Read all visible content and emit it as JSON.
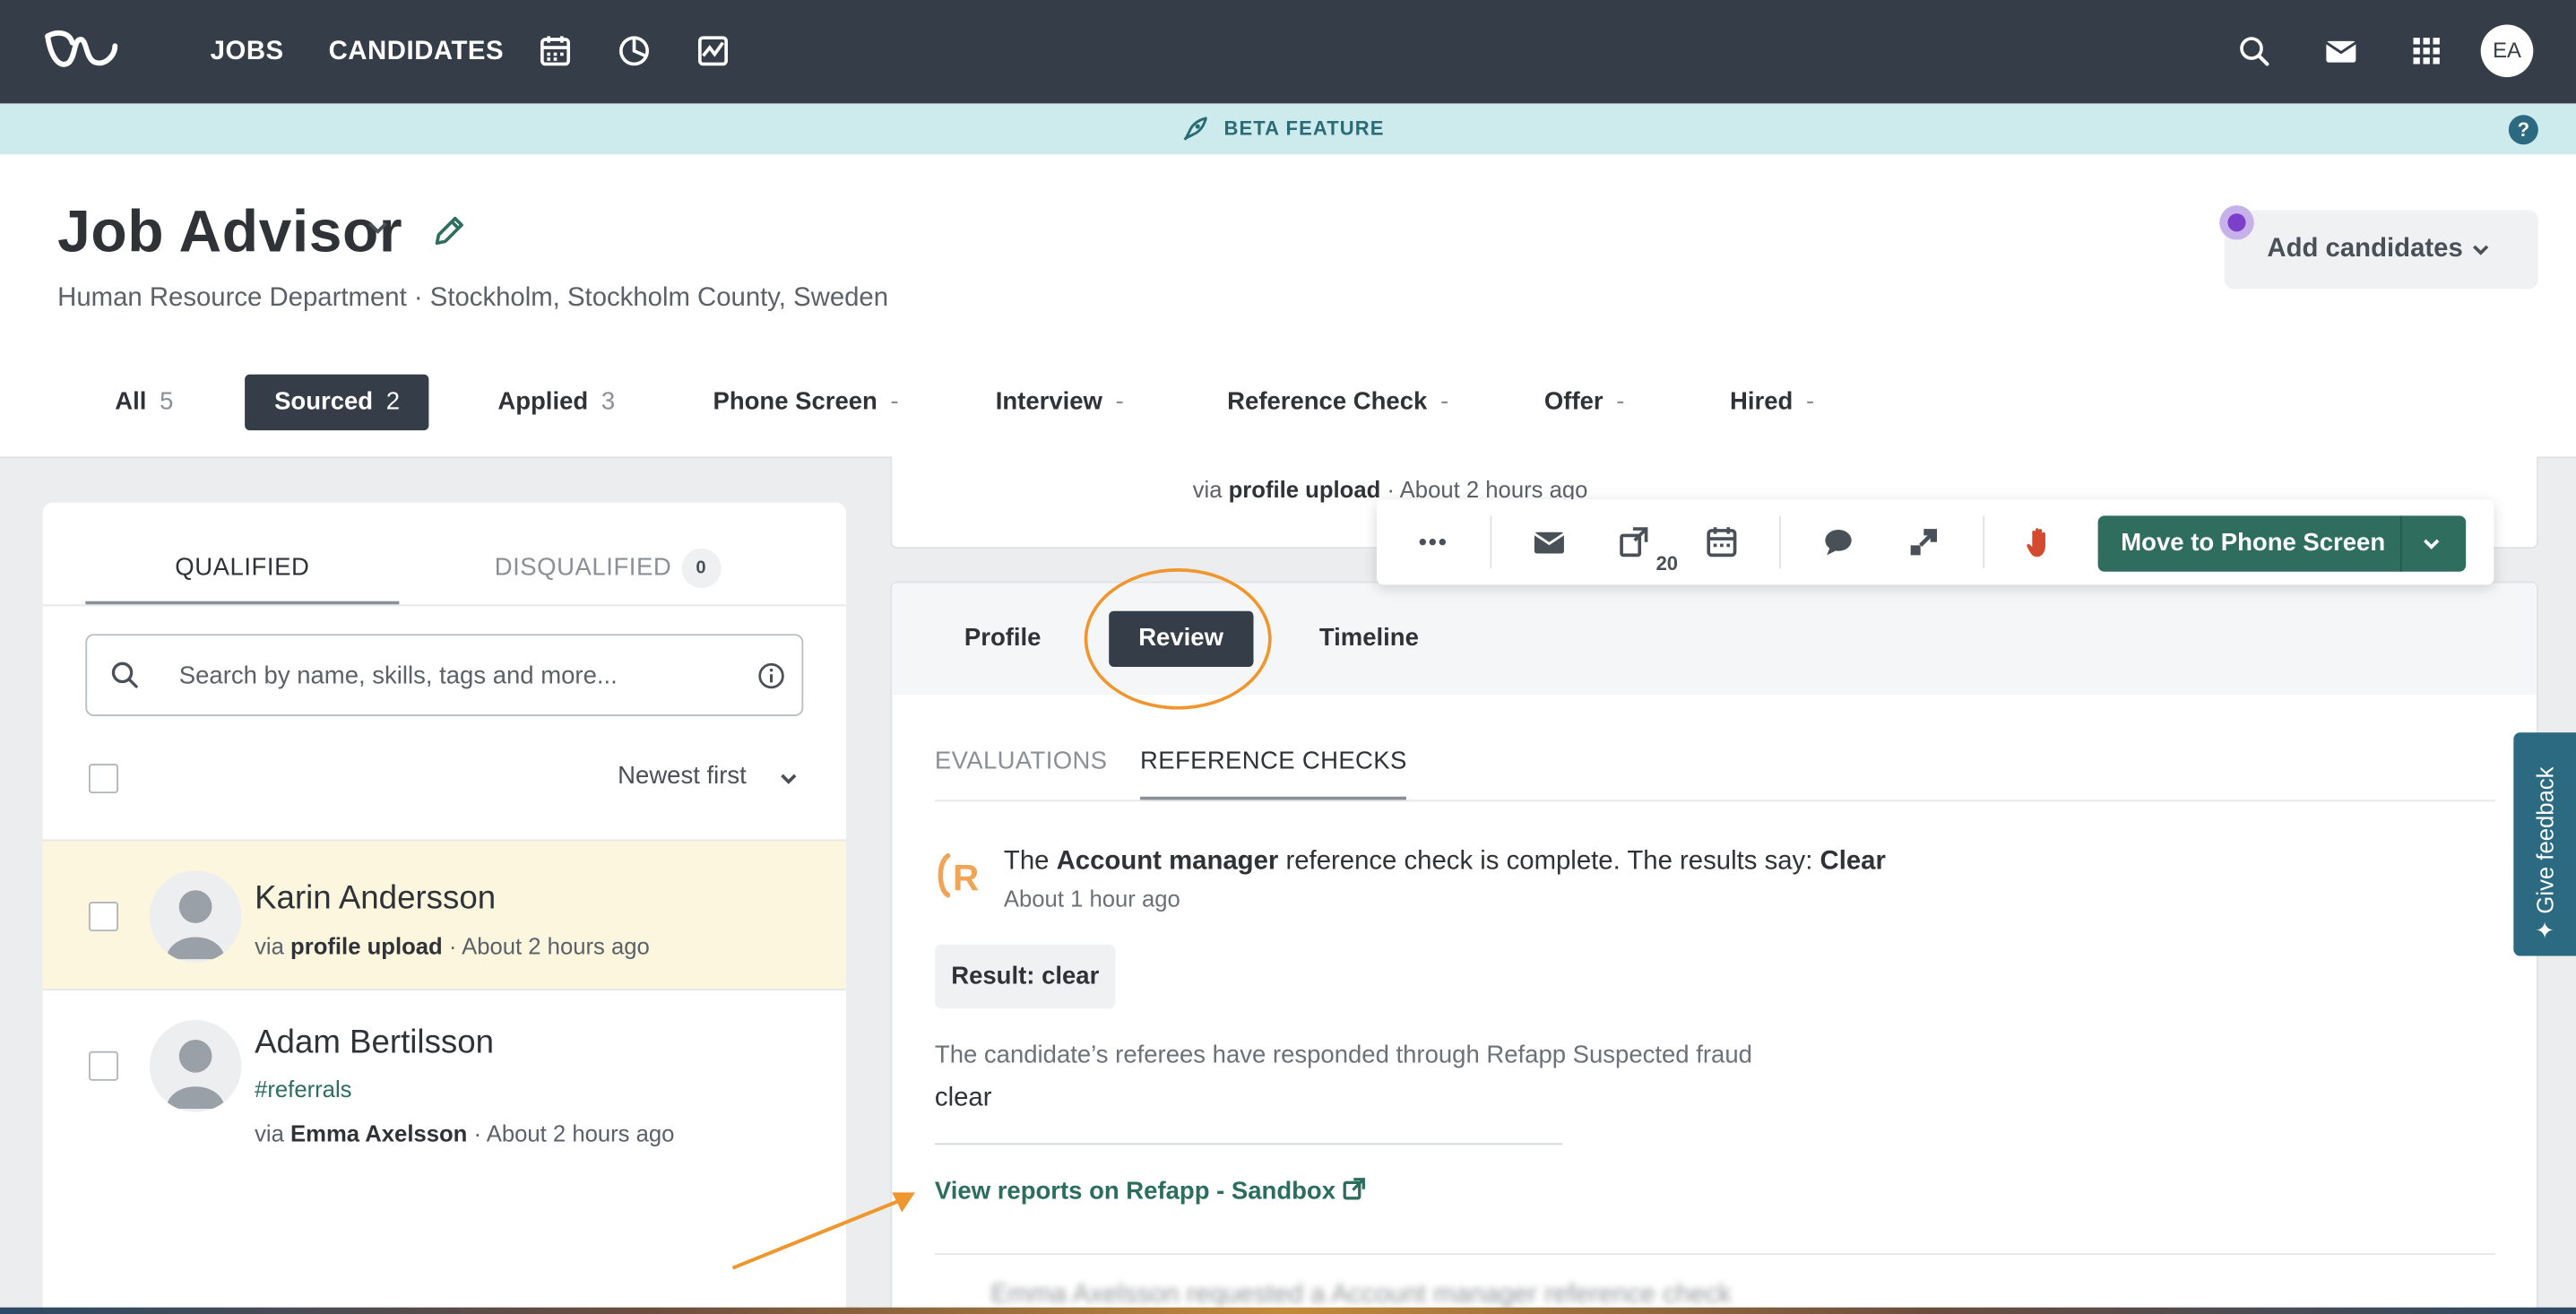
{
  "topnav": {
    "links": [
      "JOBS",
      "CANDIDATES"
    ],
    "icons": [
      "calendar-icon",
      "pie-chart-icon",
      "activity-icon",
      "search-icon",
      "mail-icon",
      "apps-grid-icon"
    ],
    "avatar_initials": "EA"
  },
  "beta": {
    "label": "BETA FEATURE",
    "help": "?"
  },
  "job": {
    "title": "Job Advisor",
    "subtitle": "Human Resource Department · Stockholm, Stockholm County, Sweden",
    "add_candidates": "Add candidates"
  },
  "stages": [
    {
      "label": "All",
      "count": "5"
    },
    {
      "label": "Sourced",
      "count": "2"
    },
    {
      "label": "Applied",
      "count": "3"
    },
    {
      "label": "Phone Screen",
      "count": "-"
    },
    {
      "label": "Interview",
      "count": "-"
    },
    {
      "label": "Reference Check",
      "count": "-"
    },
    {
      "label": "Offer",
      "count": "-"
    },
    {
      "label": "Hired",
      "count": "-"
    }
  ],
  "left": {
    "tabs": {
      "qualified": "QUALIFIED",
      "disqualified": "DISQUALIFIED",
      "disqualified_count": "0"
    },
    "search_placeholder": "Search by name, skills, tags and more...",
    "sort_label": "Newest first",
    "candidates": [
      {
        "name": "Karin Andersson",
        "via_prefix": "via",
        "via": "profile upload",
        "time": "· About 2 hours ago"
      },
      {
        "name": "Adam Bertilsson",
        "tag": "#referrals",
        "via_prefix": "via",
        "via": "Emma Axelsson",
        "time": "· About 2 hours ago"
      }
    ]
  },
  "right": {
    "top_meta": {
      "via_prefix": "via",
      "via": "profile upload",
      "time": "· About 2 hours ago"
    },
    "toolbar": {
      "attachments_count": "20",
      "move_button": "Move to Phone Screen"
    },
    "tabs": [
      "Profile",
      "Review",
      "Timeline"
    ],
    "sub_tabs": [
      "EVALUATIONS",
      "REFERENCE CHECKS"
    ],
    "reference": {
      "line_pre": "The",
      "role": "Account manager",
      "line_mid": "reference check is complete. The results say:",
      "result_word": "Clear",
      "time": "About 1 hour ago",
      "result_chip": "Result: clear",
      "description": "The candidate’s referees have responded through Refapp Suspected fraud",
      "value": "clear",
      "link": "View reports on Refapp - Sandbox"
    },
    "next_entry_partial": "Emma Axelsson requested a Account manager reference check"
  },
  "feedback": {
    "label": "✦ Give feedback"
  },
  "colors": {
    "nav": "#353d48",
    "accent": "#2f6e5e",
    "beta_bg": "#cdebed",
    "annotation": "#f0962e"
  }
}
